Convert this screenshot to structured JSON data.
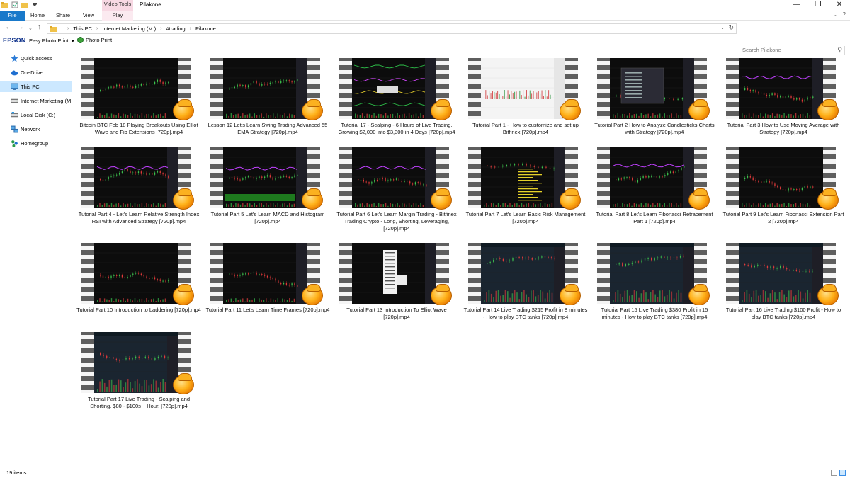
{
  "window": {
    "title": "Pilakone",
    "contextual_group": "Video Tools",
    "minimize": "—",
    "maximize": "❐",
    "close": "✕"
  },
  "ribbon": {
    "tabs": [
      "File",
      "Home",
      "Share",
      "View"
    ],
    "context_tab": "Play",
    "colors": {
      "file_tab": "#1979ca",
      "context": "#f7d8e3"
    }
  },
  "address": {
    "crumbs": [
      "This PC",
      "Internet Marketing (M:)",
      "#trading",
      "Pilakone"
    ],
    "search_placeholder": "Search Pilakone"
  },
  "toolbar": {
    "brand": "EPSON",
    "easy_photo_print": "Easy Photo Print",
    "photo_print": "Photo Print"
  },
  "nav": [
    {
      "label": "Quick access",
      "icon": "star-icon"
    },
    {
      "label": "OneDrive",
      "icon": "cloud-icon"
    },
    {
      "label": "This PC",
      "icon": "monitor-icon",
      "selected": true
    },
    {
      "label": "Internet Marketing (M",
      "icon": "drive-icon"
    },
    {
      "label": "Local Disk (C:)",
      "icon": "drive-icon"
    },
    {
      "label": "Network",
      "icon": "network-icon"
    },
    {
      "label": "Homegroup",
      "icon": "homegroup-icon"
    }
  ],
  "files": [
    {
      "name": "Bitcoin BTC Feb 18 Playing Breakouts Using Elliot Wave and Fib Extensions [720p].mp4",
      "style": "dark-candles"
    },
    {
      "name": "Lesson 12 Let's Learn Swing Trading Advanced 55 EMA Strategy [720p].mp4",
      "style": "red-green"
    },
    {
      "name": "Tutorial 17 - Scalping - 6 Hours of Live Trading. Growing $2,000 into $3,300 in 4 Days [720p].mp4",
      "style": "multi-panel"
    },
    {
      "name": "Tutorial Part 1 - How to customize and set up Bitfinex [720p].mp4",
      "style": "light"
    },
    {
      "name": "Tutorial Part 2   How to Analyze Candlesticks Charts with Strategy [720p].mp4",
      "style": "dialog"
    },
    {
      "name": "Tutorial Part 3 How to Use Moving Average with Strategy [720p].mp4",
      "style": "purple"
    },
    {
      "name": "Tutorial Part 4 -  Let's Learn Relative Strength Index RSI with Advanced Strategy [720p].mp4",
      "style": "purple"
    },
    {
      "name": "Tutorial Part 5 Let's Learn MACD and Histogram [720p].mp4",
      "style": "purple-green"
    },
    {
      "name": "Tutorial Part 6 Let's Learn Margin Trading - Bitfinex Trading Crypto - Long, Shorting, Leveraging, [720p].mp4",
      "style": "purple"
    },
    {
      "name": "Tutorial Part 7 Let's Learn Basic Risk Management [720p].mp4",
      "style": "text-yellow"
    },
    {
      "name": "Tutorial Part 8 Let's Learn Fibonacci Retracement Part 1 [720p].mp4",
      "style": "purple"
    },
    {
      "name": "Tutorial Part 9 Let's Learn Fibonacci Extension Part 2 [720p].mp4",
      "style": "dark-candles"
    },
    {
      "name": "Tutorial Part 10 Introduction to Laddering [720p].mp4",
      "style": "dark-candles"
    },
    {
      "name": "Tutorial Part 11 Let's Learn Time Frames [720p].mp4",
      "style": "red-green"
    },
    {
      "name": "Tutorial Part 13 Introduction To Elliot Wave [720p].mp4",
      "style": "menu"
    },
    {
      "name": "Tutorial Part 14 Live Trading $215 Profit in 8 minutes - How to play BTC tanks [720p].mp4",
      "style": "bitfinex"
    },
    {
      "name": "Tutorial Part 15 Live Trading $380 Profit in 15 minutes - How to play BTC tanks [720p].mp4",
      "style": "bitfinex"
    },
    {
      "name": "Tutorial Part 16 Live Trading $100 Profit - How to play BTC tanks [720p].mp4",
      "style": "bitfinex"
    },
    {
      "name": "Tutorial Part 17 Live Trading - Scalping and Shorting. $80 - $100s  _ Hour. [720p].mp4",
      "style": "bitfinex"
    }
  ],
  "status": {
    "item_count": "19 items"
  }
}
